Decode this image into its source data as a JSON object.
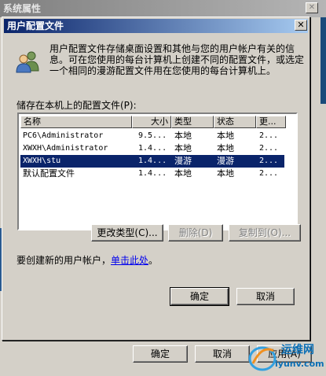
{
  "background_window": {
    "title": "系统属性",
    "close_glyph": "✕",
    "ok_label": "确定",
    "cancel_label": "取消",
    "apply_label": "应用(A)"
  },
  "dialog": {
    "title": "用户配置文件",
    "close_glyph": "✕",
    "description": "用户配置文件存储桌面设置和其他与您的用户帐户有关的信息。可在您使用的每台计算机上创建不同的配置文件，或选定一个相同的漫游配置文件用在您使用的每台计算机上。",
    "stored_label": "储存在本机上的配置文件(P):",
    "columns": [
      "名称",
      "大小",
      "类型",
      "状态",
      "更..."
    ],
    "profiles": [
      {
        "name": "PC6\\Administrator",
        "size": "9.5...",
        "type": "本地",
        "status": "本地",
        "modified": "2..."
      },
      {
        "name": "XWXH\\Administrator",
        "size": "1.4...",
        "type": "本地",
        "status": "本地",
        "modified": "2..."
      },
      {
        "name": "XWXH\\stu",
        "size": "1.4...",
        "type": "漫游",
        "status": "漫游",
        "modified": "2..."
      },
      {
        "name": "默认配置文件",
        "size": "1.4...",
        "type": "本地",
        "status": "本地",
        "modified": "2..."
      }
    ],
    "selected_index": 2,
    "change_type_label": "更改类型(C)...",
    "delete_label": "删除(D)",
    "copy_to_label": "复制到(O)...",
    "create_prefix": "要创建新的用户帐户，",
    "create_link": "单击此处",
    "create_suffix": "。",
    "ok_label": "确定",
    "cancel_label": "取消"
  },
  "watermark": {
    "name": "运维网",
    "url": "iyunv.com"
  },
  "colors": {
    "title_active": "#0a246a",
    "selection": "#0a246a",
    "face": "#d4d0c8",
    "link": "#0000ee"
  }
}
